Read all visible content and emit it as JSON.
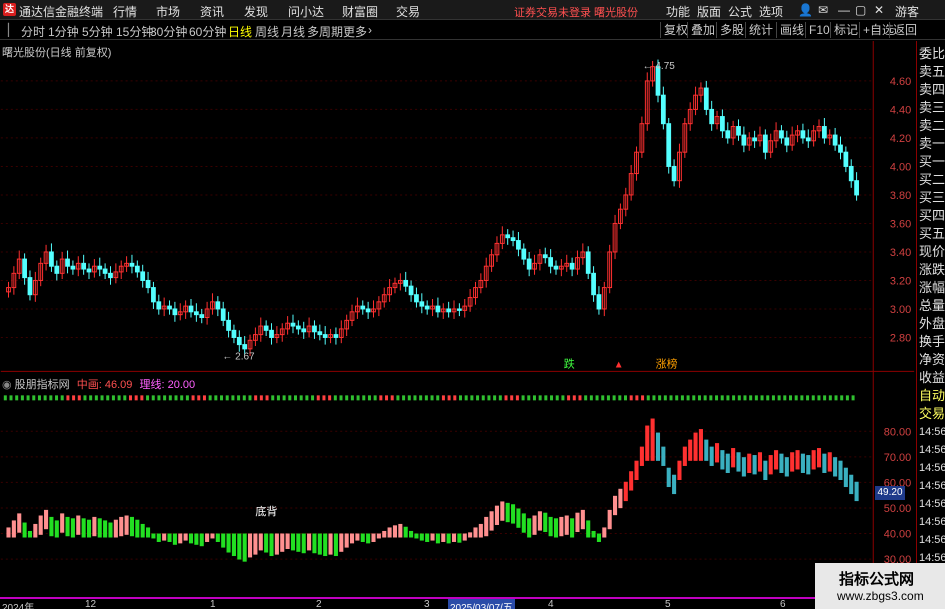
{
  "app": {
    "name": "通达信金融终端",
    "menus": [
      "行情",
      "市场",
      "资讯",
      "发现",
      "问小达",
      "财富圈",
      "交易"
    ],
    "notice": "证券交易未登录 曙光股份",
    "top_right": [
      "功能",
      "版面",
      "公式",
      "选项"
    ],
    "guest": "游客"
  },
  "periods": {
    "items": [
      "分时",
      "1分钟",
      "5分钟",
      "15分钟",
      "30分钟",
      "60分钟",
      "日线",
      "周线",
      "月线",
      "多周期",
      "更多"
    ],
    "active": "日线"
  },
  "toolbar": [
    "复权",
    "叠加",
    "多股",
    "统计",
    "画线",
    "F10",
    "标记",
    "+自选",
    "返回"
  ],
  "stock_label": "曙光股份(日线 前复权)",
  "indicator": {
    "name": "股朋指标网",
    "mid_label": "中画:",
    "mid_value": "46.09",
    "line_label": "理线:",
    "line_value": "20.00"
  },
  "right_panel": [
    "委比",
    "卖五",
    "卖四",
    "卖三",
    "卖二",
    "卖一",
    "买一",
    "买二",
    "买三",
    "买四",
    "买五",
    "现价",
    "涨跌",
    "涨幅",
    "总量",
    "外盘",
    "换手",
    "净资",
    "收益",
    "自动",
    "交易",
    "14:56",
    "14:56",
    "14:56",
    "14:56",
    "14:56",
    "14:56",
    "14:56",
    "14:56"
  ],
  "price_box": "49.20",
  "annotations": {
    "high": "4.75",
    "low": "2.67",
    "bottom_tag": "底背",
    "event1": "跌",
    "event2": "涨榜"
  },
  "main_axis": [
    "4.60",
    "4.40",
    "4.20",
    "4.00",
    "3.80",
    "3.60",
    "3.40",
    "3.20",
    "3.00",
    "2.80"
  ],
  "ind_axis": [
    "80.00",
    "70.00",
    "60.00",
    "50.00",
    "40.00",
    "30.00"
  ],
  "time_axis": [
    "2024年",
    "12",
    "1",
    "2",
    "3",
    "2025/03/07/五",
    "4",
    "5",
    "6"
  ],
  "watermark": {
    "line1": "指标公式网",
    "line2": "www.zbgs3.com"
  },
  "colors": {
    "up": "#ff3030",
    "down": "#54ffff",
    "green": "#22e022",
    "pink": "#ff9090",
    "cyan": "#3ab0c0"
  }
}
